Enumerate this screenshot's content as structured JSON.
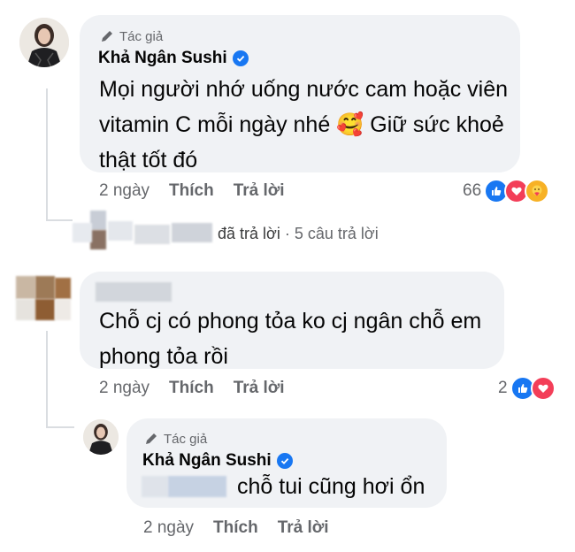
{
  "comment1": {
    "author_tag": "Tác giả",
    "author_name": "Khả Ngân Sushi",
    "text_lines": [
      "Mọi người nhớ uống nước cam hoặc viên",
      "vitamin C mỗi ngày nhé 🥰 Giữ sức khoẻ",
      "thật tốt  đó"
    ],
    "time": "2 ngày",
    "like_label": "Thích",
    "reply_label": "Trả lời",
    "reaction_count": "66",
    "reactions": [
      "like-icon",
      "love-icon",
      "care-icon"
    ]
  },
  "replies_summary": {
    "action_text": "đã trả lời",
    "separator": "·",
    "count_text": "5 câu trả lời"
  },
  "comment2": {
    "text_lines": [
      "Chỗ cj có phong tỏa ko cj ngân chỗ em",
      "phong tỏa rồi"
    ],
    "time": "2 ngày",
    "like_label": "Thích",
    "reply_label": "Trả lời",
    "reaction_count": "2",
    "reactions": [
      "like-icon",
      "love-icon"
    ]
  },
  "comment3": {
    "author_tag": "Tác giả",
    "author_name": "Khả Ngân Sushi",
    "text": "chỗ tui cũng hơi ổn",
    "time": "2 ngày",
    "like_label": "Thích",
    "reply_label": "Trả lời"
  },
  "colors": {
    "bubble": "#f0f2f5",
    "secondary_text": "#65676b",
    "verified_blue": "#1877f2",
    "like_blue": "#1877f2",
    "love_red": "#f33e58",
    "care_yellow": "#f7b125"
  }
}
